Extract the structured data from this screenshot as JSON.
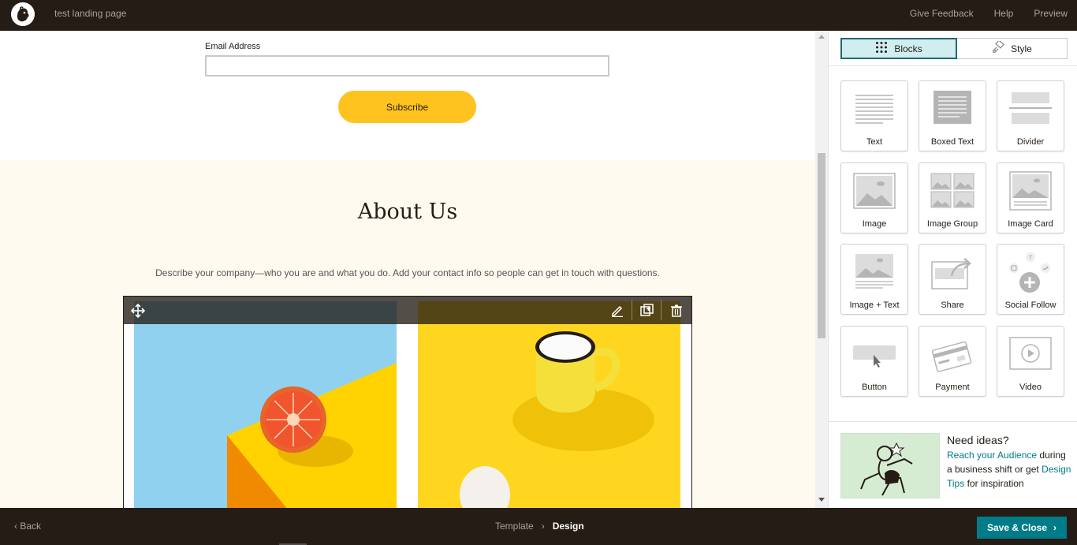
{
  "header": {
    "title": "test landing page",
    "links": [
      "Give Feedback",
      "Help",
      "Preview"
    ]
  },
  "canvas": {
    "email_label": "Email Address",
    "email_placeholder": "",
    "subscribe_label": "Subscribe",
    "about_title": "About Us",
    "about_description": "Describe your company—who you are and what you do. Add your contact info so people can get in touch with questions."
  },
  "block_toolbar": {
    "icons": [
      "move-icon",
      "edit-icon",
      "duplicate-icon",
      "delete-icon"
    ]
  },
  "panel": {
    "tabs": [
      {
        "label": "Blocks",
        "icon": "grid-dots-icon",
        "active": true
      },
      {
        "label": "Style",
        "icon": "paint-icon",
        "active": false
      }
    ],
    "blocks": [
      {
        "label": "Text",
        "icon": "text-block-icon"
      },
      {
        "label": "Boxed Text",
        "icon": "boxed-text-icon"
      },
      {
        "label": "Divider",
        "icon": "divider-icon"
      },
      {
        "label": "Image",
        "icon": "image-icon"
      },
      {
        "label": "Image Group",
        "icon": "image-group-icon"
      },
      {
        "label": "Image Card",
        "icon": "image-card-icon"
      },
      {
        "label": "Image + Text",
        "icon": "image-text-icon"
      },
      {
        "label": "Share",
        "icon": "share-icon"
      },
      {
        "label": "Social Follow",
        "icon": "social-follow-icon"
      },
      {
        "label": "Button",
        "icon": "button-block-icon"
      },
      {
        "label": "Payment",
        "icon": "payment-icon"
      },
      {
        "label": "Video",
        "icon": "video-icon"
      }
    ],
    "ideas": {
      "title": "Need ideas?",
      "link1": "Reach your Audience",
      "text1": " during a business shift or get ",
      "link2": "Design Tips",
      "text2": " for inspiration"
    }
  },
  "footer": {
    "back_label": "Back",
    "crumb_template": "Template",
    "crumb_design": "Design",
    "save_label": "Save & Close"
  },
  "colors": {
    "dark": "#241c15",
    "accent_teal": "#007c89",
    "subscribe_yellow": "#ffc320",
    "about_bg": "#fefaef",
    "tab_active_bg": "#d0eef0"
  }
}
